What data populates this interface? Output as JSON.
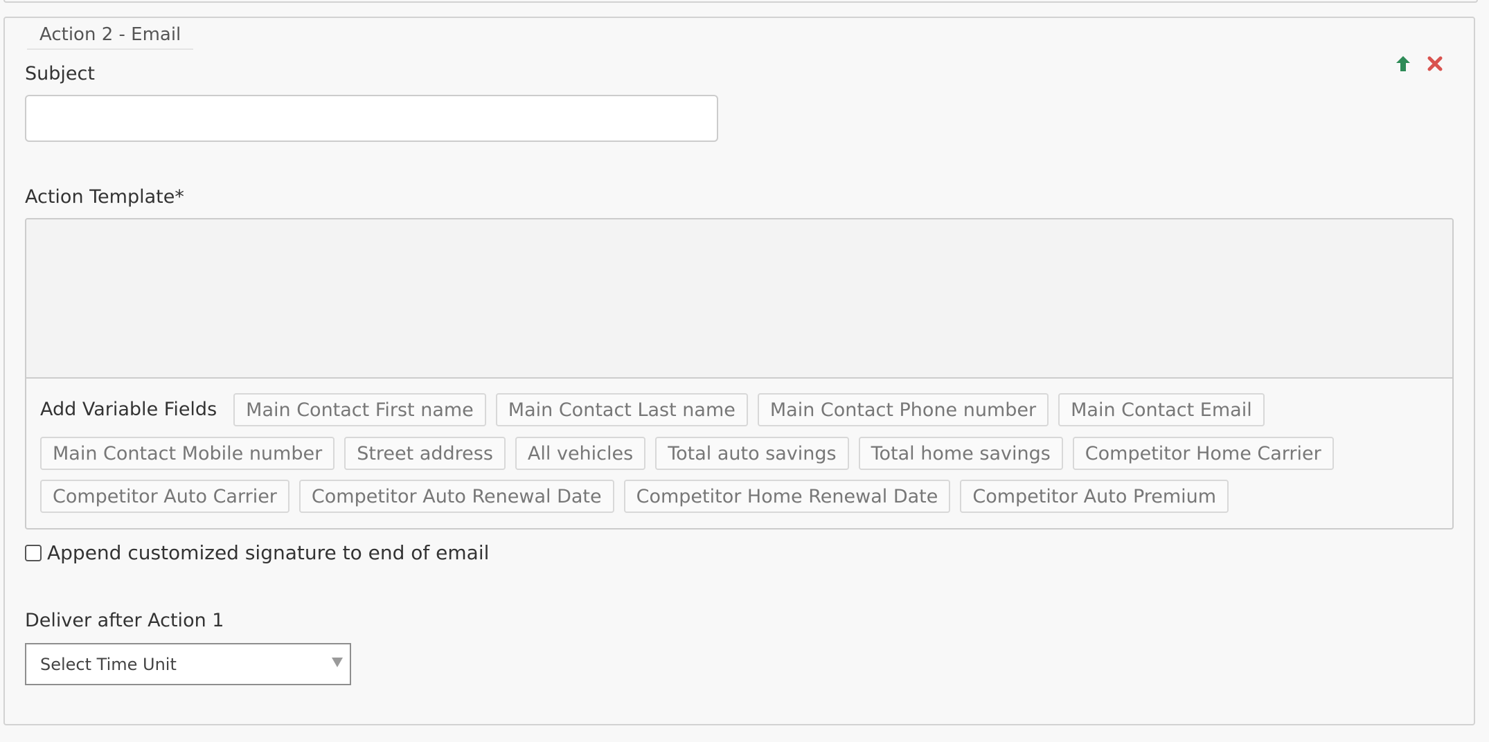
{
  "action_header": {
    "title": "Action 2 - Email"
  },
  "icons": {
    "up": "arrow-up-icon",
    "remove": "close-icon",
    "up_color": "#2e8b57",
    "remove_color": "#d9534f"
  },
  "subject": {
    "label": "Subject",
    "value": "",
    "placeholder": ""
  },
  "template": {
    "label": "Action Template*",
    "variable_fields_label": "Add Variable Fields",
    "variable_fields": [
      "Main Contact First name",
      "Main Contact Last name",
      "Main Contact Phone number",
      "Main Contact Email",
      "Main Contact Mobile number",
      "Street address",
      "All vehicles",
      "Total auto savings",
      "Total home savings",
      "Competitor Home Carrier",
      "Competitor Auto Carrier",
      "Competitor Auto Renewal Date",
      "Competitor Home Renewal Date",
      "Competitor Auto Premium"
    ]
  },
  "signature": {
    "label": "Append customized signature to end of email",
    "checked": false
  },
  "delivery": {
    "label": "Deliver after Action 1",
    "select_value": "Select Time Unit"
  }
}
